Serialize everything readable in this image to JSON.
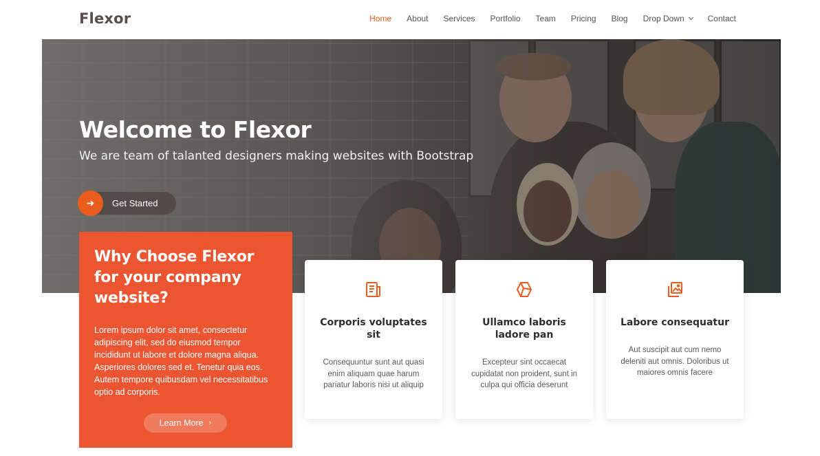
{
  "brand": {
    "logo": "Flexor",
    "accent": "#eb5d1e",
    "box_color": "#eb5532"
  },
  "nav": {
    "items": [
      {
        "label": "Home",
        "active": true
      },
      {
        "label": "About",
        "active": false
      },
      {
        "label": "Services",
        "active": false
      },
      {
        "label": "Portfolio",
        "active": false
      },
      {
        "label": "Team",
        "active": false
      },
      {
        "label": "Pricing",
        "active": false
      },
      {
        "label": "Blog",
        "active": false
      },
      {
        "label": "Drop Down",
        "active": false,
        "icon": "chevron-down-icon"
      },
      {
        "label": "Contact",
        "active": false
      }
    ]
  },
  "hero": {
    "title": "Welcome to Flexor",
    "subtitle": "We are team of talanted designers making websites with Bootstrap",
    "cta_label": "Get Started",
    "cta_icon": "arrow-right-icon"
  },
  "why": {
    "title": "Why Choose Flexor for your company website?",
    "text": "Lorem ipsum dolor sit amet, consectetur adipiscing elit, sed do eiusmod tempor incididunt ut labore et dolore magna aliqua. Asperiores dolores sed et. Tenetur quia eos. Autem tempore quibusdam vel necessitatibus optio ad corporis.",
    "button_label": "Learn More",
    "button_icon": "chevron-right-icon"
  },
  "cards": [
    {
      "icon": "document-icon",
      "title": "Corporis voluptates sit",
      "text": "Consequuntur sunt aut quasi enim aliquam quae harum pariatur laboris nisi ut aliquip"
    },
    {
      "icon": "cube-icon",
      "title": "Ullamco laboris ladore pan",
      "text": "Excepteur sint occaecat cupidatat non proident, sunt in culpa qui officia deserunt"
    },
    {
      "icon": "images-icon",
      "title": "Labore consequatur",
      "text": "Aut suscipit aut cum nemo deleniti aut omnis. Doloribus ut maiores omnis facere"
    }
  ]
}
